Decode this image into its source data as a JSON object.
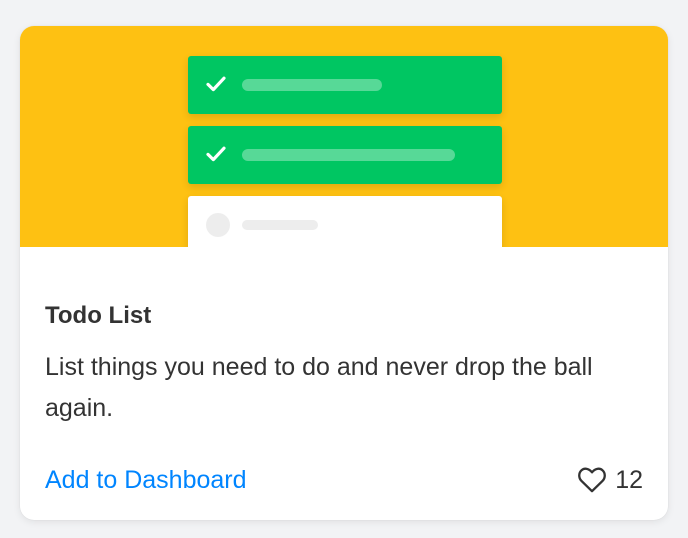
{
  "card": {
    "title": "Todo List",
    "description": "List things you need to do and never drop the ball again.",
    "action_label": "Add to Dashboard",
    "likes": "12"
  },
  "illustration": {
    "background_color": "#fec112",
    "completed_task_color": "#00c662",
    "pending_task_color": "#ffffff",
    "tasks": [
      {
        "state": "completed",
        "icon": "checkmark-icon"
      },
      {
        "state": "completed",
        "icon": "checkmark-icon"
      },
      {
        "state": "pending",
        "icon": "empty-circle-icon"
      }
    ]
  },
  "colors": {
    "link": "#0085ff",
    "text": "#333333",
    "card_background": "#ffffff"
  },
  "icons": {
    "like": "heart-outline-icon"
  }
}
